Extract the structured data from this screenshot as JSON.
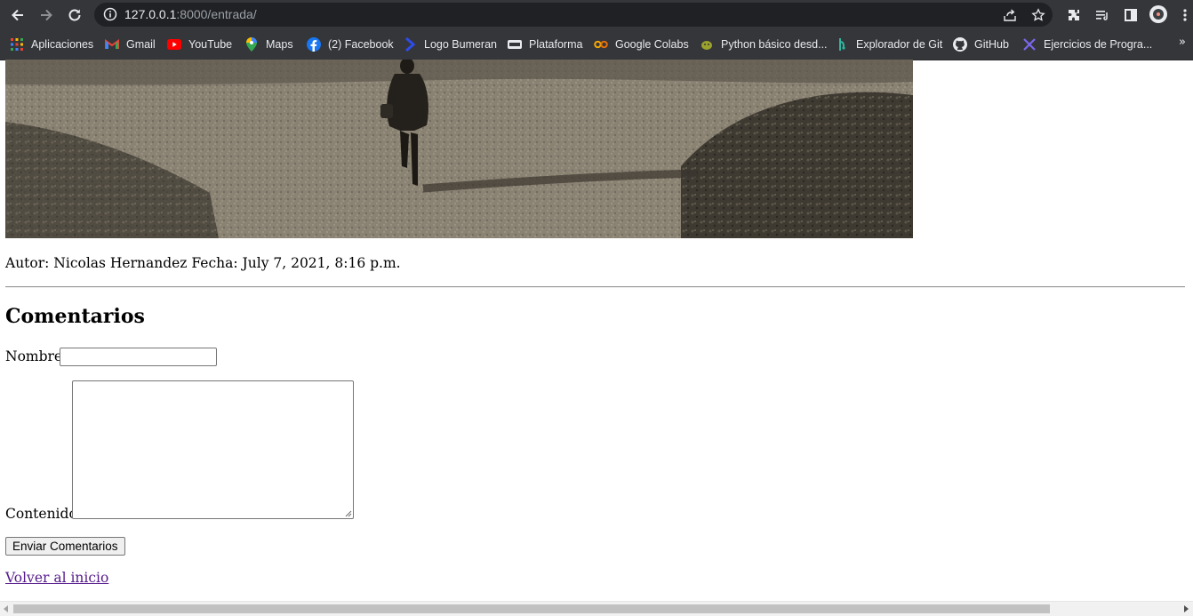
{
  "browser": {
    "url_host": "127.0.0.1",
    "url_rest": ":8000/entrada/",
    "bookmarks": [
      {
        "label": "Aplicaciones",
        "icon": "apps-grid-icon"
      },
      {
        "label": "Gmail",
        "icon": "gmail-icon"
      },
      {
        "label": "YouTube",
        "icon": "youtube-icon"
      },
      {
        "label": "Maps",
        "icon": "maps-icon"
      },
      {
        "label": "(2) Facebook",
        "icon": "facebook-icon"
      },
      {
        "label": "Logo Bumeran",
        "icon": "bumeran-icon"
      },
      {
        "label": "Plataforma",
        "icon": "platform-icon"
      },
      {
        "label": "Google Colabs",
        "icon": "colab-icon"
      },
      {
        "label": "Python básico desd...",
        "icon": "python-icon"
      },
      {
        "label": "Explorador de Git",
        "icon": "git-explorer-icon"
      },
      {
        "label": "GitHub",
        "icon": "github-icon"
      },
      {
        "label": "Ejercicios de Progra...",
        "icon": "exercises-icon"
      }
    ],
    "more_bookmarks": "»"
  },
  "page": {
    "meta_line": "Autor: Nicolas Hernandez Fecha: July 7, 2021, 8:16 p.m.",
    "comments_heading": "Comentarios",
    "form": {
      "name_label": "Nombre:",
      "name_value": "",
      "content_label": "Contenido:",
      "content_value": "",
      "submit_label": "Enviar Comentarios"
    },
    "back_link": "Volver al inicio"
  },
  "colors": {
    "chrome_bg": "#35363a",
    "omnibox_bg": "#202124",
    "visited_link": "#551a8b"
  }
}
